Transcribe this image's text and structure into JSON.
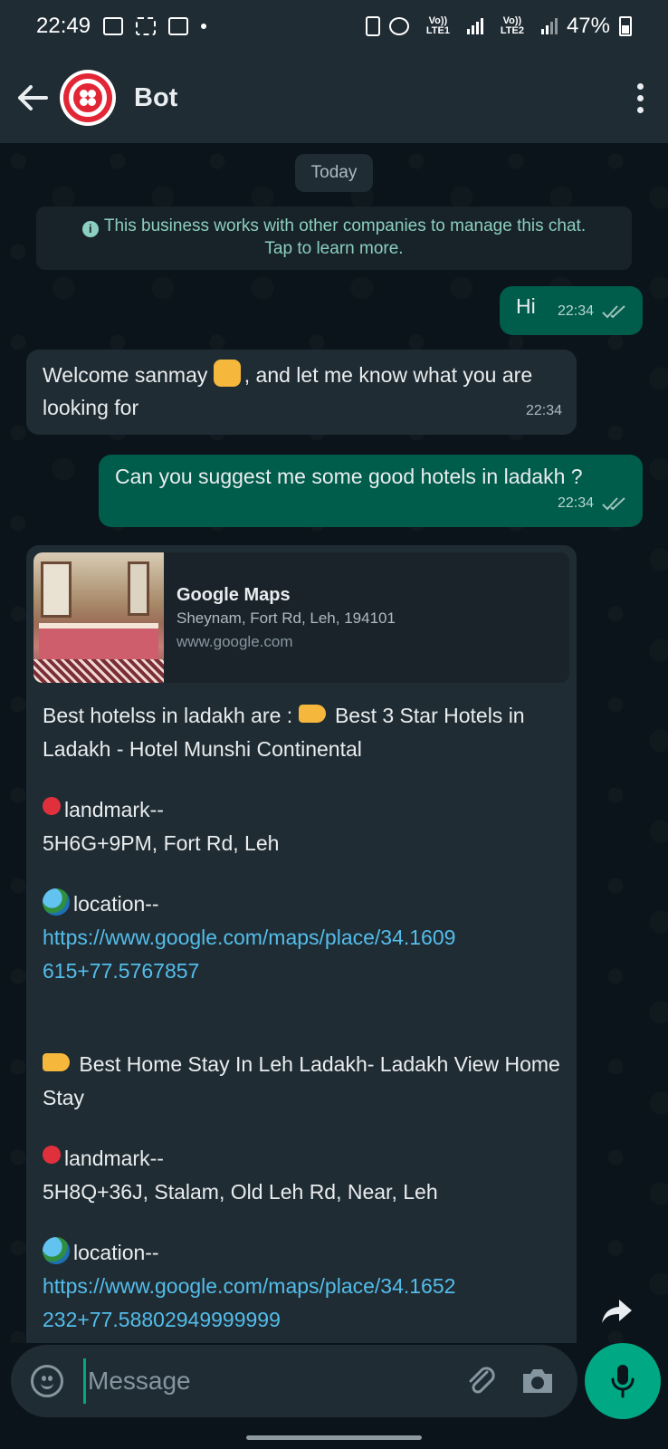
{
  "status_bar": {
    "time": "22:49",
    "network_1": "Vo)) LTE1",
    "network_2": "Vo)) LTE2",
    "battery": "47%"
  },
  "header": {
    "title": "Bot"
  },
  "chat": {
    "date_chip": "Today",
    "system_note": {
      "line1": "This business works with other companies to manage this chat.",
      "line2": "Tap to learn more."
    },
    "messages": [
      {
        "text": "Hi",
        "time": "22:34"
      },
      {
        "text_before": "Welcome sanmay ",
        "text_after": ", and let me know what you are looking for",
        "time": "22:34"
      },
      {
        "text": "Can you suggest me some good hotels in ladakh ?",
        "time": "22:34"
      }
    ],
    "rich_message": {
      "preview": {
        "title": "Google Maps",
        "subtitle": "Sheynam, Fort Rd, Leh, 194101",
        "domain": "www.google.com"
      },
      "intro_prefix": "Best hotelss in ladakh are : ",
      "hotel1_name": " Best 3 Star Hotels in Ladakh - Hotel Munshi Continental",
      "landmark_label": "landmark--",
      "hotel1_landmark": "5H6G+9PM, Fort Rd, Leh",
      "location_label": "location--",
      "hotel1_url": "https://www.google.com/maps/place/34.1609615+77.5767857",
      "hotel2_name": " Best Home Stay In Leh Ladakh- Ladakh View Home Stay",
      "hotel2_landmark": "5H8Q+36J, Stalam, Old Leh Rd, Near, Leh",
      "hotel2_url": "https://www.google.com/maps/place/34.1652232+77.58802949999999"
    }
  },
  "composer": {
    "placeholder": "Message"
  },
  "colors": {
    "background": "#0b141a",
    "header": "#1f2c34",
    "outgoing_bubble": "#005c4b",
    "incoming_bubble": "#202c33",
    "accent": "#00a884",
    "link": "#53bdeb"
  },
  "icons": [
    "back-arrow-icon",
    "more-options-icon",
    "info-icon",
    "read-ticks-icon",
    "forward-icon",
    "emoji-icon",
    "attach-icon",
    "camera-icon",
    "mic-icon"
  ]
}
